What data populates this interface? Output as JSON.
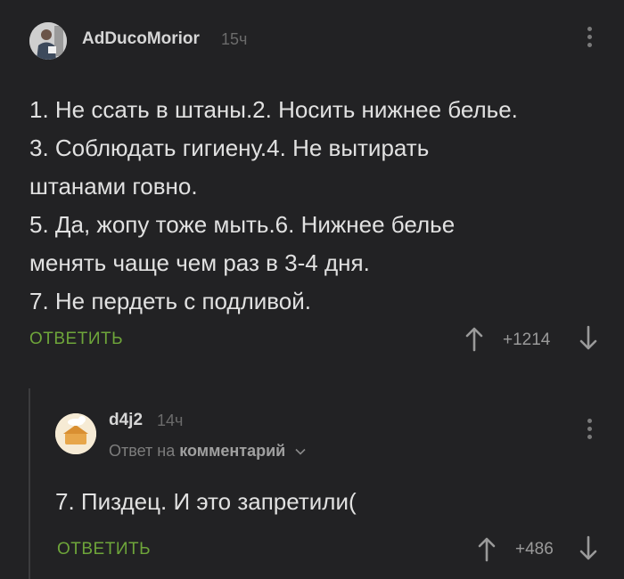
{
  "comment": {
    "author": "AdDucoMorior",
    "time": "15ч",
    "lines": [
      "1. Не ссать в штаны.2. Носить нижнее белье.",
      "3. Соблюдать гигиену.4. Не вытирать",
      "штанами говно.",
      "5. Да, жопу тоже мыть.6. Нижнее белье",
      "менять чаще чем раз в 3-4 дня.",
      "7. Не пердеть с подливой."
    ],
    "reply_label": "ОТВЕТИТЬ",
    "score": "+1214"
  },
  "reply": {
    "author": "d4j2",
    "time": "14ч",
    "reply_to_prefix": "Ответ на",
    "reply_to_link": "комментарий",
    "text": "7. Пиздец. И это запретили(",
    "reply_label": "ОТВЕТИТЬ",
    "score": "+486"
  },
  "icons": {
    "more": "more-vertical-icon",
    "upvote": "arrow-up-icon",
    "downvote": "arrow-down-icon",
    "chevron": "chevron-down-icon"
  },
  "colors": {
    "background": "#222224",
    "accent_green": "#6ea53a",
    "text": "#e1e1e1",
    "muted": "#6b6b6b"
  }
}
